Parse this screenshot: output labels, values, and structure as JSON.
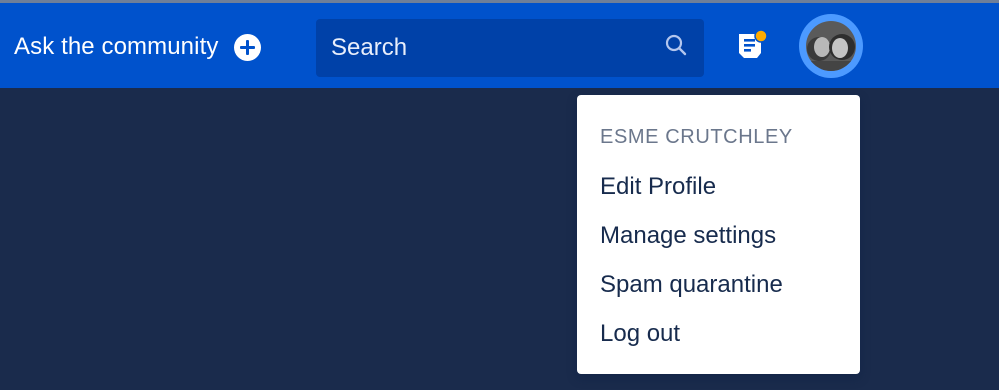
{
  "header": {
    "ask_label": "Ask the community",
    "search_placeholder": "Search",
    "colors": {
      "navbar": "#0052cc",
      "search_bg": "#0041a8",
      "avatar_ring": "#4c9aff",
      "notification_dot": "#ffab00",
      "page_bg": "#1a2b4c"
    }
  },
  "icons": [
    "plus-circle-icon",
    "search-icon",
    "notifications-icon",
    "avatar"
  ],
  "user_menu": {
    "name": "ESME CRUTCHLEY",
    "items": [
      {
        "label": "Edit Profile"
      },
      {
        "label": "Manage settings"
      },
      {
        "label": "Spam quarantine"
      },
      {
        "label": "Log out"
      }
    ]
  }
}
